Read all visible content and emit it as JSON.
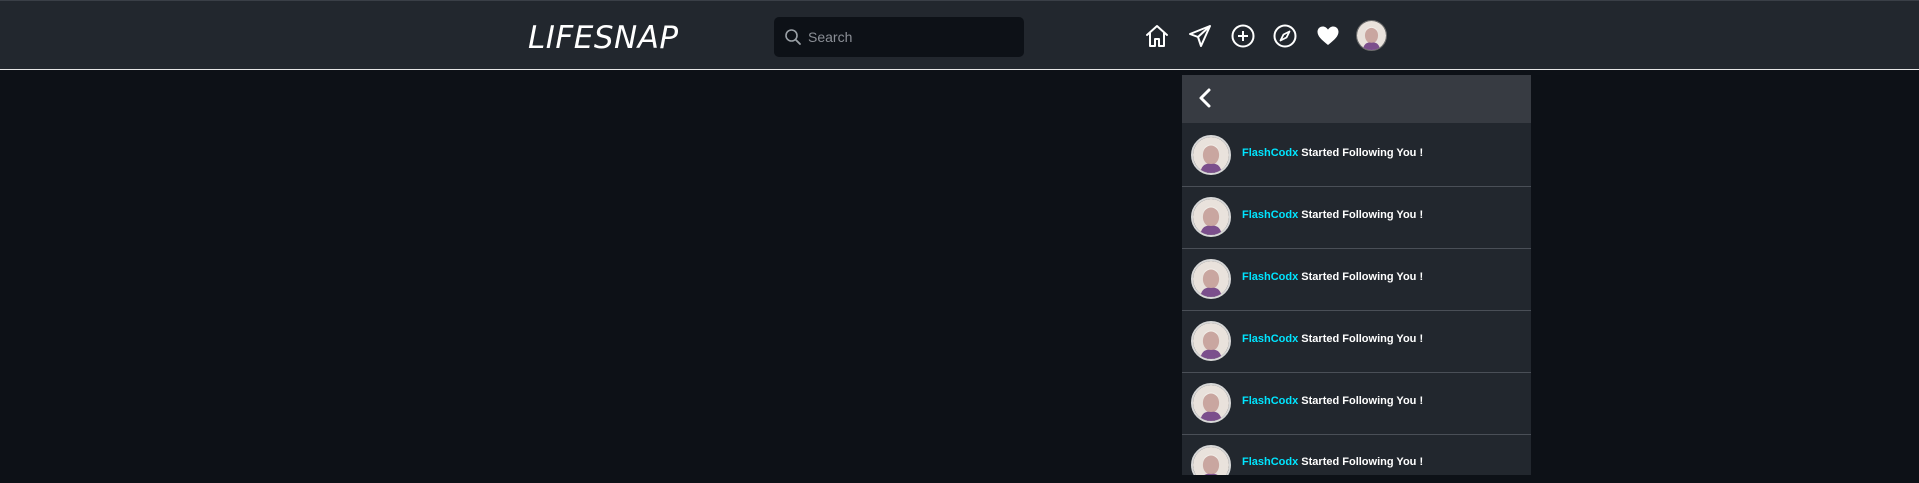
{
  "navbar": {
    "logo": "LIFESNAP",
    "search": {
      "placeholder": "Search",
      "value": ""
    },
    "icons": [
      "home-icon",
      "send-icon",
      "add-post-icon",
      "explore-icon",
      "heart-icon"
    ]
  },
  "colors": {
    "background": "#0d1117",
    "navbar": "#22272e",
    "panel": "#22272e",
    "panel_header": "#373b42",
    "username": "#00e5ff",
    "text": "#ffffff"
  },
  "notifications": {
    "items": [
      {
        "user": "FlashCodx",
        "message": "Started Following You !"
      },
      {
        "user": "FlashCodx",
        "message": "Started Following You !"
      },
      {
        "user": "FlashCodx",
        "message": "Started Following You !"
      },
      {
        "user": "FlashCodx",
        "message": "Started Following You !"
      },
      {
        "user": "FlashCodx",
        "message": "Started Following You !"
      },
      {
        "user": "FlashCodx",
        "message": "Started Following You !"
      }
    ]
  }
}
